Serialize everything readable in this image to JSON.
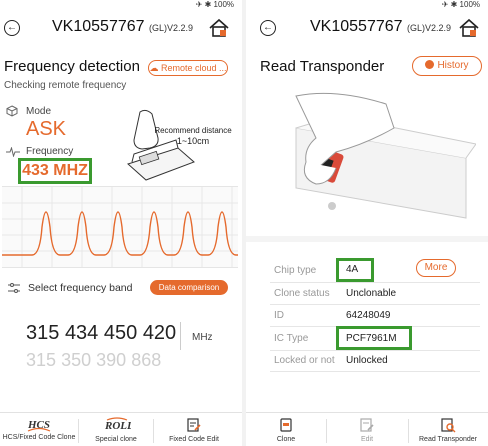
{
  "left": {
    "device_title": "VK10557767",
    "device_suffix": "(GL)V2.2.9",
    "status": "✈ ✱ 100%",
    "section_title": "Frequency detection",
    "subtitle": "Checking remote frequency",
    "remote_button": "Remote cloud ...",
    "mode_label": "Mode",
    "mode_value": "ASK",
    "frequency_label": "Frequency",
    "frequency_value": "433 MHZ",
    "recommend_label": "Recommend distance",
    "recommend_value": "1~10cm",
    "select_band_label": "Select frequency band",
    "data_comparison_button": "Data comparison",
    "bands_primary": [
      "315",
      "434",
      "450",
      "420"
    ],
    "bands_secondary": [
      "315",
      "350",
      "390",
      "868"
    ],
    "unit": "MHz",
    "nav": [
      {
        "label": "HCS/Fixed Code Clone",
        "icon": "hcs-logo-icon"
      },
      {
        "label": "Special clone",
        "icon": "roll-logo-icon"
      },
      {
        "label": "Fixed Code Edit",
        "icon": "edit-icon"
      }
    ]
  },
  "right": {
    "device_title": "VK10557767",
    "device_suffix": "(GL)V2.2.9",
    "status": "✈ ✱ 100%",
    "section_title": "Read Transponder",
    "history_button": "History",
    "more_button": "More",
    "rows": [
      {
        "label": "Chip type",
        "value": "4A"
      },
      {
        "label": "Clone status",
        "value": "Unclonable"
      },
      {
        "label": "ID",
        "value": "64248049"
      },
      {
        "label": "IC Type",
        "value": "PCF7961M"
      },
      {
        "label": "Locked or not",
        "value": "Unlocked"
      }
    ],
    "nav": [
      {
        "label": "Clone",
        "icon": "clone-icon"
      },
      {
        "label": "Edit",
        "icon": "edit-icon"
      },
      {
        "label": "Read Transponder",
        "icon": "read-transponder-icon"
      }
    ]
  },
  "colors": {
    "accent": "#e56a2d",
    "highlight": "#3a9a2f"
  }
}
